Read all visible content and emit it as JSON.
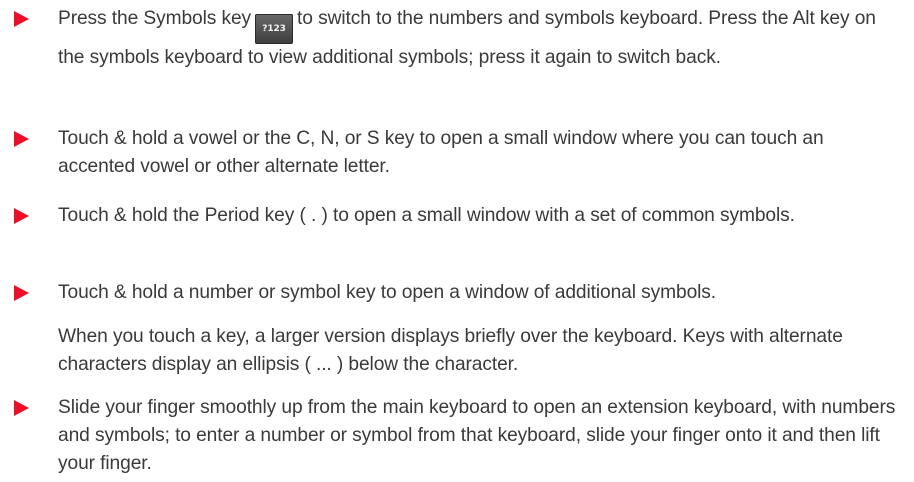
{
  "colors": {
    "bullet": "#e8102a",
    "text": "#3a3a3a",
    "key_background": "#4a4a4a"
  },
  "items": [
    {
      "bullet_icon": "right-triangle-bullet-icon",
      "before_key": "Press the Symbols key",
      "key_label": "?123",
      "after_key": "to switch to the numbers and symbols keyboard. Press the Alt key on the symbols keyboard to view additional symbols; press it again to switch back."
    },
    {
      "bullet_icon": "right-triangle-bullet-icon",
      "text": "Touch & hold a vowel or the C, N, or S key to open a small window where you can touch an accented vowel or other alternate letter."
    },
    {
      "bullet_icon": "right-triangle-bullet-icon",
      "text": "Touch & hold the Period key ( . ) to open a small window with a set of common symbols."
    },
    {
      "bullet_icon": "right-triangle-bullet-icon",
      "text": "Touch & hold a number or symbol key to open a window of additional symbols.",
      "note": "When you touch a key, a larger version displays briefly over the keyboard. Keys with alternate characters display an ellipsis ( ... ) below the character."
    },
    {
      "bullet_icon": "right-triangle-bullet-icon",
      "text": "Slide your finger smoothly up from the main keyboard to open an extension keyboard, with numbers and symbols; to enter a number or symbol from that keyboard, slide your finger onto it and then lift your finger."
    }
  ]
}
